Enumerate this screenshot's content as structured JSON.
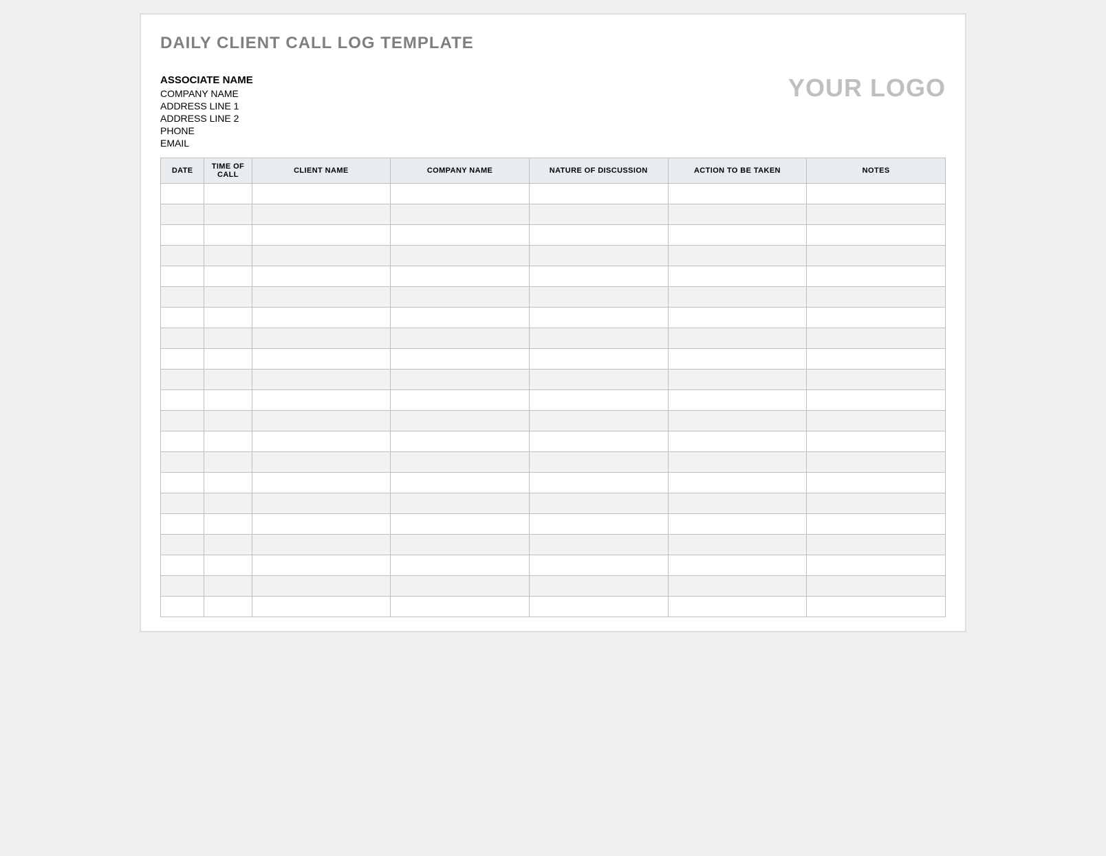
{
  "title": "DAILY CLIENT CALL LOG TEMPLATE",
  "contact": {
    "associate_name": "ASSOCIATE NAME",
    "company_name": "COMPANY NAME",
    "address_line_1": "ADDRESS LINE 1",
    "address_line_2": "ADDRESS LINE 2",
    "phone": "PHONE",
    "email": "EMAIL"
  },
  "logo_placeholder": "YOUR LOGO",
  "table": {
    "headers": {
      "date": "DATE",
      "time_of_call": "TIME OF CALL",
      "client_name": "CLIENT NAME",
      "company_name": "COMPANY NAME",
      "nature_of_discussion": "NATURE OF DISCUSSION",
      "action_to_be_taken": "ACTION TO BE TAKEN",
      "notes": "NOTES"
    },
    "row_count": 21
  }
}
